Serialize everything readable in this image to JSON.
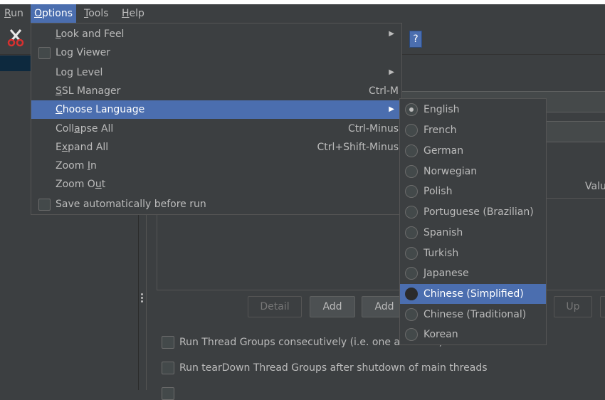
{
  "menubar": {
    "items": [
      {
        "label": "Run",
        "mnemonic": "R",
        "rest": "un"
      },
      {
        "label": "Options",
        "mnemonic": "O",
        "rest": "ptions"
      },
      {
        "label": "Tools",
        "mnemonic": "T",
        "rest": "ools"
      },
      {
        "label": "Help",
        "mnemonic": "H",
        "rest": "elp"
      }
    ],
    "active": "Options"
  },
  "toolbar": {
    "help_glyph": "?"
  },
  "options_menu": {
    "items": [
      {
        "pre": "",
        "mn": "L",
        "post": "ook and Feel",
        "accelerator": "",
        "submenu": true,
        "checkbox": false
      },
      {
        "pre": "Log Viewer",
        "mn": "",
        "post": "",
        "accelerator": "",
        "submenu": false,
        "checkbox": true
      },
      {
        "pre": "Log Level",
        "mn": "",
        "post": "",
        "accelerator": "",
        "submenu": true,
        "checkbox": false
      },
      {
        "pre": "",
        "mn": "S",
        "post": "SL Manager",
        "accelerator": "Ctrl-M",
        "submenu": false,
        "checkbox": false
      },
      {
        "pre": "",
        "mn": "C",
        "post": "hoose Language",
        "accelerator": "",
        "submenu": true,
        "checkbox": false
      },
      {
        "pre": "Coll",
        "mn": "a",
        "post": "pse All",
        "accelerator": "Ctrl-Minus",
        "submenu": false,
        "checkbox": false
      },
      {
        "pre": "E",
        "mn": "x",
        "post": "pand All",
        "accelerator": "Ctrl+Shift-Minus",
        "submenu": false,
        "checkbox": false
      },
      {
        "pre": "Zoom ",
        "mn": "I",
        "post": "n",
        "accelerator": "",
        "submenu": false,
        "checkbox": false
      },
      {
        "pre": "Zoom O",
        "mn": "u",
        "post": "t",
        "accelerator": "",
        "submenu": false,
        "checkbox": false
      },
      {
        "pre": "Save automatically before run",
        "mn": "",
        "post": "",
        "accelerator": "",
        "submenu": false,
        "checkbox": true
      }
    ],
    "highlighted": "Choose Language"
  },
  "language_menu": {
    "items": [
      "English",
      "French",
      "German",
      "Norwegian",
      "Polish",
      "Portuguese (Brazilian)",
      "Spanish",
      "Turkish",
      "Japanese",
      "Chinese (Simplified)",
      "Chinese (Traditional)",
      "Korean"
    ],
    "selected": "English",
    "highlighted": "Chinese (Simplified)"
  },
  "table": {
    "value_header": "Valu"
  },
  "buttons": {
    "detail": "Detail",
    "add": "Add",
    "add_from_clipboard": "Add",
    "up": "Up"
  },
  "options": {
    "run_consecutively": "Run Thread Groups consecutively (i.e. one at a time)",
    "run_teardown": "Run tearDown Thread Groups after shutdown of main threads"
  },
  "colors": {
    "accent": "#4b6eaf",
    "background": "#3c3f41",
    "text": "#bbbbbb"
  }
}
